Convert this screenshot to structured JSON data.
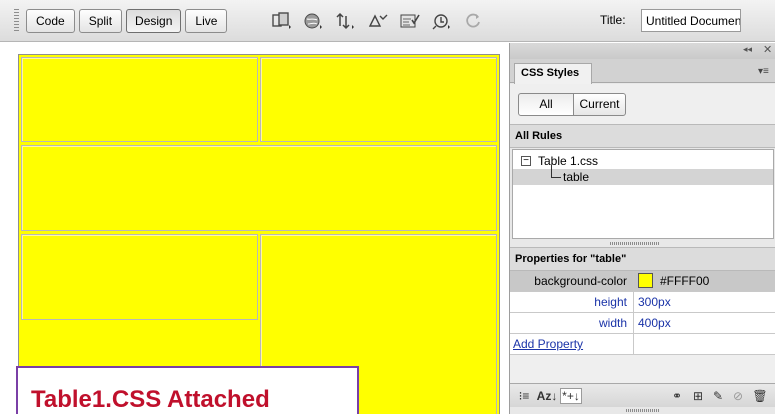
{
  "toolbar": {
    "views": [
      {
        "label": "Code",
        "active": false
      },
      {
        "label": "Split",
        "active": false
      },
      {
        "label": "Design",
        "active": true
      },
      {
        "label": "Live",
        "active": false
      }
    ],
    "tool_icons": [
      "multiscreen-icon",
      "preview-browser-icon",
      "file-management-icon",
      "w3c-validation-icon",
      "check-browser-icon",
      "visual-aids-icon",
      "refresh-icon"
    ],
    "title_label": "Title:",
    "title_value": "Untitled Document"
  },
  "canvas": {
    "table_background": "#FFFF00",
    "callout_text": "Table1.CSS Attached",
    "callout_border_color": "#7A3FA6",
    "callout_text_color": "#C0102C"
  },
  "panel": {
    "tab_label": "CSS Styles",
    "toggle_all": "All",
    "toggle_current": "Current",
    "rules_header": "All Rules",
    "rules_tree": [
      {
        "label": "Table 1.css",
        "expanded": true
      },
      {
        "label": "table",
        "selected": true
      }
    ],
    "properties_header": "Properties for \"table\"",
    "properties": [
      {
        "name": "background-color",
        "value": "#FFFF00",
        "swatch": "#FFFF00",
        "selected": true
      },
      {
        "name": "height",
        "value": "300px"
      },
      {
        "name": "width",
        "value": "400px"
      }
    ],
    "add_property": "Add Property",
    "bottom_icons_left": [
      "category-view-icon",
      "alpha-sort-icon",
      "set-properties-only-icon"
    ],
    "bottom_icons_right": [
      "attach-stylesheet-icon",
      "new-css-rule-icon",
      "edit-rule-icon",
      "disable-property-icon",
      "delete-icon"
    ]
  }
}
